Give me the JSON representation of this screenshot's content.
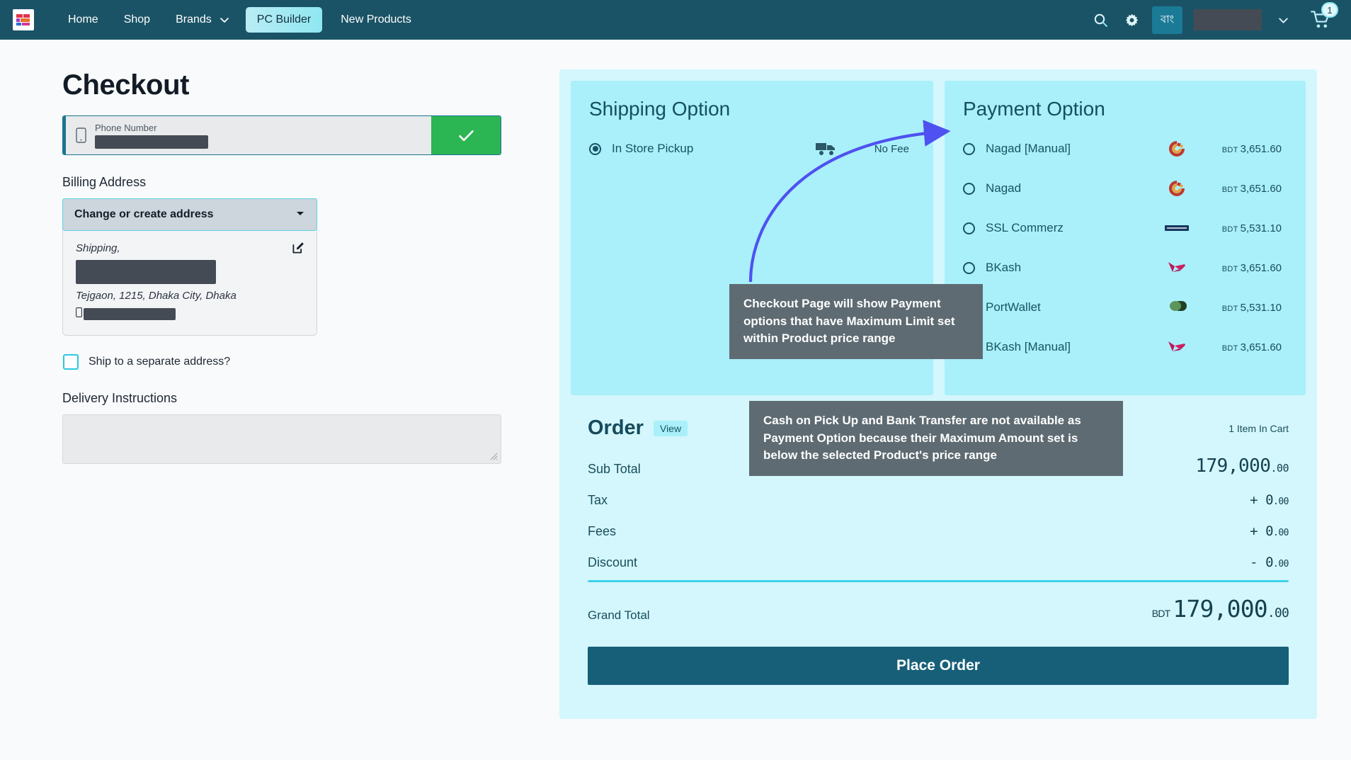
{
  "navbar": {
    "logo_name": "site-logo",
    "links": [
      {
        "label": "Home",
        "name": "nav-home"
      },
      {
        "label": "Shop",
        "name": "nav-shop"
      },
      {
        "label": "Brands",
        "name": "nav-brands"
      },
      {
        "label": "New Products",
        "name": "nav-new-products"
      }
    ],
    "active_pill": "PC Builder",
    "lang_toggle": "বাং",
    "cart_badge": "1"
  },
  "page": {
    "title": "Checkout"
  },
  "phone": {
    "label": "Phone Number",
    "value": "",
    "confirm_icon": "check-icon"
  },
  "billing": {
    "heading": "Billing Address",
    "select_label": "Change or create address",
    "address_type": "Shipping,",
    "address_line": "Tejgaon, 1215, Dhaka City, Dhaka",
    "ship_separate_label": "Ship to a separate address?",
    "ship_separate_checked": false
  },
  "delivery": {
    "heading": "Delivery Instructions",
    "value": "",
    "placeholder": ""
  },
  "shipping_option": {
    "title": "Shipping Option",
    "items": [
      {
        "label": "In Store Pickup",
        "selected": true,
        "icon": "truck-icon",
        "fee": "No Fee"
      }
    ]
  },
  "payment_option": {
    "title": "Payment Option",
    "currency": "BDT",
    "items": [
      {
        "label": "Nagad [Manual]",
        "selected": false,
        "icon": "nagad-icon",
        "currency": "BDT",
        "amount": "3,651.60"
      },
      {
        "label": "Nagad",
        "selected": false,
        "icon": "nagad-icon",
        "currency": "BDT",
        "amount": "3,651.60"
      },
      {
        "label": "SSL Commerz",
        "selected": false,
        "icon": "sslcommerz-icon",
        "currency": "BDT",
        "amount": "5,531.10"
      },
      {
        "label": "BKash",
        "selected": false,
        "icon": "bkash-icon",
        "currency": "BDT",
        "amount": "3,651.60"
      },
      {
        "label": "PortWallet",
        "selected": false,
        "icon": "portwallet-icon",
        "currency": "BDT",
        "amount": "5,531.10"
      },
      {
        "label": "BKash [Manual]",
        "selected": false,
        "icon": "bkash-icon",
        "currency": "BDT",
        "amount": "3,651.60"
      }
    ]
  },
  "order": {
    "title": "Order",
    "view_label": "View",
    "cart_count_label": "1 Item In Cart",
    "rows": [
      {
        "label": "Sub Total",
        "whole": "179,000",
        "cents": ".00",
        "prefix": ""
      },
      {
        "label": "Tax",
        "whole": "0",
        "cents": ".00",
        "prefix": "+ "
      },
      {
        "label": "Fees",
        "whole": "0",
        "cents": ".00",
        "prefix": "+ "
      },
      {
        "label": "Discount",
        "whole": "0",
        "cents": ".00",
        "prefix": "- "
      }
    ],
    "grand_total_label": "Grand Total",
    "grand_total_currency": "BDT",
    "grand_total_whole": "179,000",
    "grand_total_cents": ".00",
    "place_order_label": "Place Order"
  },
  "annotations": [
    {
      "id": "callout-1",
      "text": "Checkout Page will show Payment options that have Maximum Limit set within Product price range"
    },
    {
      "id": "callout-2",
      "text": "Cash on Pick Up and Bank Transfer are not available as Payment Option because their Maximum Amount set is below the selected Product's price range"
    }
  ],
  "colors": {
    "nav_bg": "#1a5366",
    "accent_cyan": "#a9f0fa",
    "card_bg": "#d3f7fc",
    "button": "#175f78",
    "green": "#2cb553",
    "arrow": "#4f51f0"
  }
}
